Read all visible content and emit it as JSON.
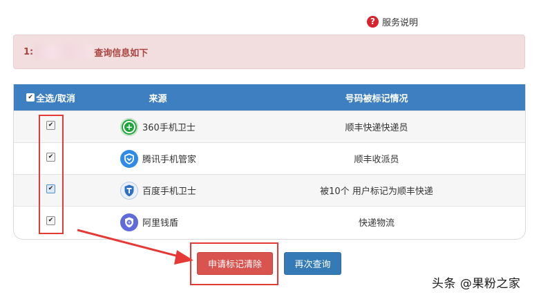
{
  "help": {
    "label": "服务说明",
    "icon": "question-circle-icon"
  },
  "alert": {
    "prefix": "1:",
    "suffix": "查询信息如下"
  },
  "table": {
    "headers": {
      "select": "全选/取消",
      "source": "来源",
      "status": "号码被标记情况"
    },
    "rows": [
      {
        "source": "360手机卫士",
        "status": "顺丰快递快递员",
        "icon": "360-guard-icon",
        "checked": true
      },
      {
        "source": "腾讯手机管家",
        "status": "顺丰收派员",
        "icon": "tencent-shield-icon",
        "checked": true
      },
      {
        "source": "百度手机卫士",
        "status": "被10个 用户标记为顺丰快递",
        "icon": "baidu-guard-icon",
        "checked": true
      },
      {
        "source": "阿里钱盾",
        "status": "快递物流",
        "icon": "ali-qiandun-icon",
        "checked": true
      }
    ]
  },
  "buttons": {
    "clear": "申请标记清除",
    "requery": "再次查询"
  },
  "watermark": "头条 @果粉之家",
  "colors": {
    "header": "#3d7fc0",
    "alert_bg": "#f2dede",
    "alert_text": "#a94442",
    "annotation": "#e53935"
  }
}
